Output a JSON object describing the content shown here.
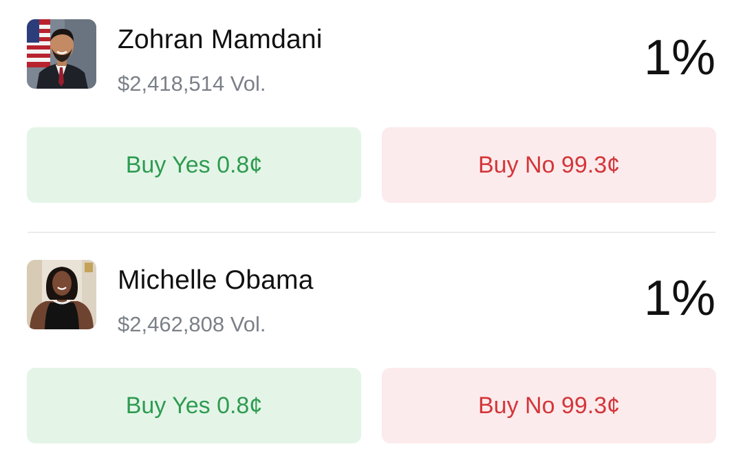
{
  "markets": [
    {
      "avatar_icon": "portrait-man-suit-flag",
      "name": "Zohran Mamdani",
      "volume": "$2,418,514 Vol.",
      "probability": "1%",
      "buy_yes": "Buy Yes 0.8¢",
      "buy_no": "Buy No 99.3¢"
    },
    {
      "avatar_icon": "portrait-woman-black-dress",
      "name": "Michelle Obama",
      "volume": "$2,462,808 Vol.",
      "probability": "1%",
      "buy_yes": "Buy Yes 0.8¢",
      "buy_no": "Buy No 99.3¢"
    }
  ],
  "colors": {
    "yes_bg": "#e4f5e8",
    "yes_text": "#2e9b50",
    "no_bg": "#fcebec",
    "no_text": "#d3363a",
    "volume_text": "#7b8088"
  }
}
